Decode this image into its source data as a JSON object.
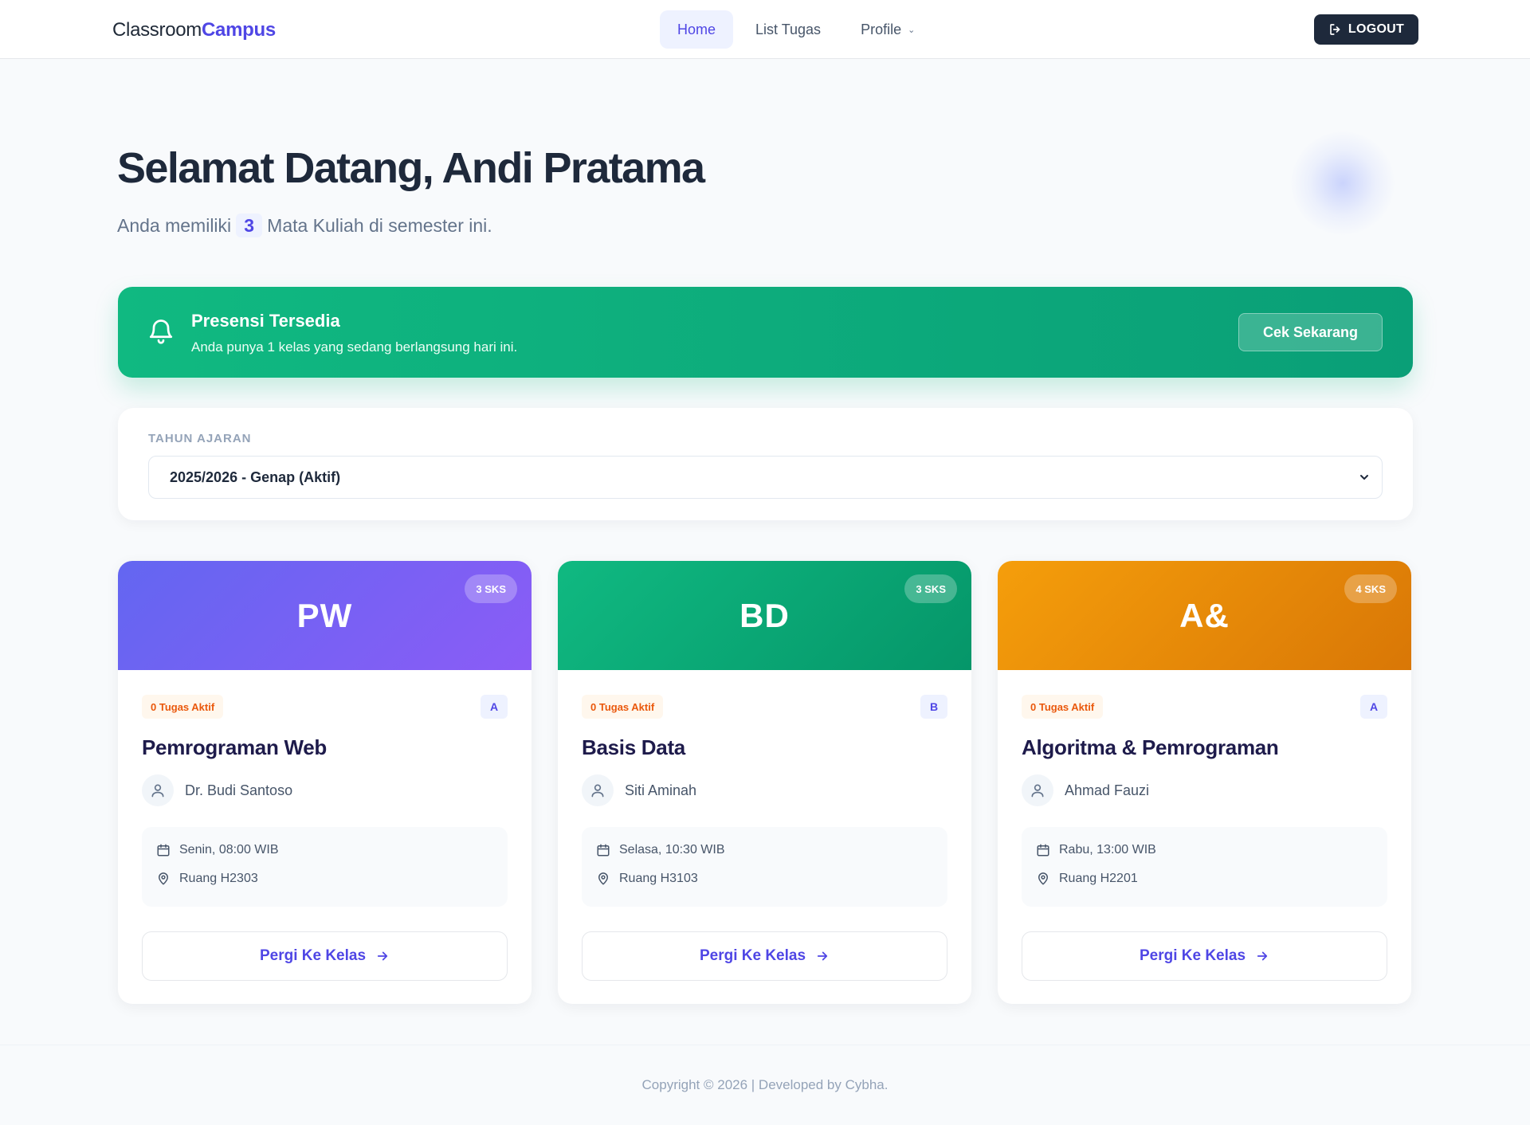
{
  "brand": {
    "prefix": "Classroom",
    "accent": "Campus"
  },
  "nav": {
    "items": [
      {
        "label": "Home",
        "active": true
      },
      {
        "label": "List Tugas",
        "active": false
      },
      {
        "label": "Profile",
        "active": false,
        "has_dropdown": true
      }
    ],
    "logout_label": "LOGOUT"
  },
  "hero": {
    "title": "Selamat Datang, Andi Pratama",
    "sub_prefix": "Anda memiliki",
    "course_count": "3",
    "sub_suffix": "Mata Kuliah di semester ini."
  },
  "presensi": {
    "title": "Presensi Tersedia",
    "text": "Anda punya 1 kelas yang sedang berlangsung hari ini.",
    "button_label": "Cek Sekarang"
  },
  "year": {
    "label": "TAHUN AJARAN",
    "selected": "2025/2026 - Genap (Aktif)"
  },
  "courses": [
    {
      "abbr": "PW",
      "sks": "3 SKS",
      "tasks": "0 Tugas Aktif",
      "class": "A",
      "name": "Pemrograman Web",
      "lecturer": "Dr. Budi Santoso",
      "schedule": "Senin, 08:00 WIB",
      "room": "Ruang H2303",
      "button_label": "Pergi Ke Kelas",
      "gradient": [
        "#6366f1",
        "#8b5cf6"
      ]
    },
    {
      "abbr": "BD",
      "sks": "3 SKS",
      "tasks": "0 Tugas Aktif",
      "class": "B",
      "name": "Basis Data",
      "lecturer": "Siti Aminah",
      "schedule": "Selasa, 10:30 WIB",
      "room": "Ruang H3103",
      "button_label": "Pergi Ke Kelas",
      "gradient": [
        "#10b981",
        "#059669"
      ]
    },
    {
      "abbr": "A&",
      "sks": "4 SKS",
      "tasks": "0 Tugas Aktif",
      "class": "A",
      "name": "Algoritma & Pemrograman",
      "lecturer": "Ahmad Fauzi",
      "schedule": "Rabu, 13:00 WIB",
      "room": "Ruang H2201",
      "button_label": "Pergi Ke Kelas",
      "gradient": [
        "#f59e0b",
        "#d97706"
      ]
    }
  ],
  "footer": {
    "text": "Copyright © 2026 | Developed by Cybha."
  },
  "icons": {
    "logout": "logout-icon",
    "bell": "bell-icon",
    "caret": "chevron-down-icon",
    "user": "user-icon",
    "calendar": "calendar-icon",
    "location": "map-pin-icon",
    "arrow": "arrow-right-icon"
  },
  "colors": {
    "primary": "#4f46e5",
    "success": "#10b981",
    "dark": "#1e293b",
    "warning_text": "#ea580c"
  }
}
